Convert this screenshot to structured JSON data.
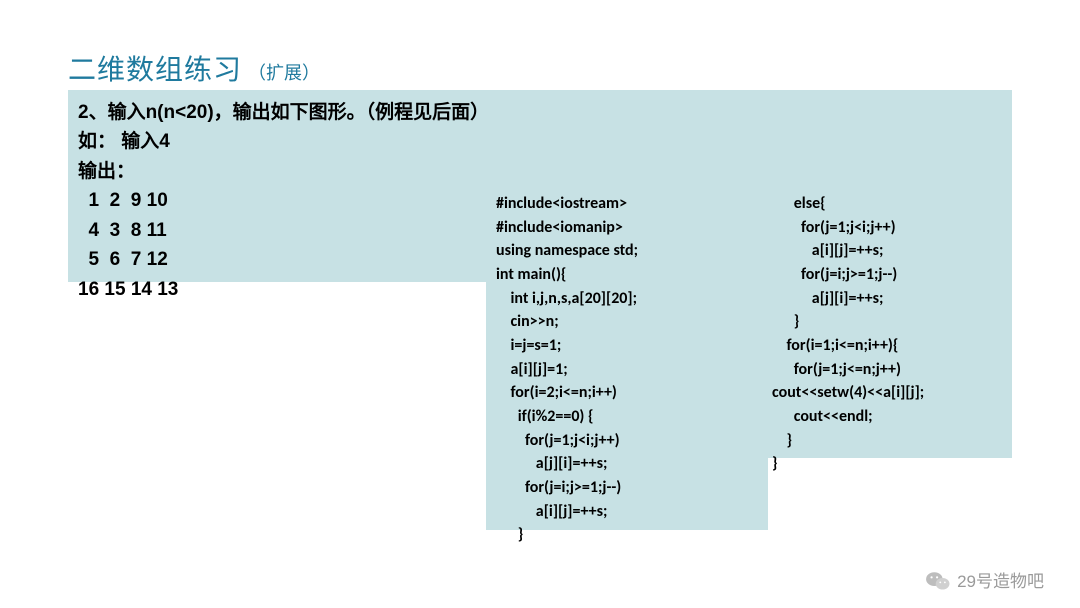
{
  "title": {
    "main": "二维数组练习",
    "sub": "（扩展）"
  },
  "problem": {
    "lines": [
      "2、输入n(n<20)，输出如下图形。（例程见后面）",
      "如： 输入4",
      "输出：",
      "  1  2  9 10",
      "  4  3  8 11",
      "  5  6  7 12",
      "16 15 14 13"
    ]
  },
  "code_left": [
    "#include<iostream>",
    "#include<iomanip>",
    "using namespace std;",
    "int main(){",
    "    int i,j,n,s,a[20][20];",
    "    cin>>n;",
    "    i=j=s=1;",
    "    a[i][j]=1;",
    "    for(i=2;i<=n;i++)",
    "      if(i%2==0) {",
    "        for(j=1;j<i;j++)",
    "           a[j][i]=++s;",
    "        for(j=i;j>=1;j--)",
    "           a[i][j]=++s;",
    "      }"
  ],
  "code_right": [
    "      else{",
    "        for(j=1;j<i;j++)",
    "           a[i][j]=++s;",
    "        for(j=i;j>=1;j--)",
    "           a[j][i]=++s;",
    "      }",
    "    for(i=1;i<=n;i++){",
    "      for(j=1;j<=n;j++)",
    "cout<<setw(4)<<a[i][j];",
    "      cout<<endl;",
    "    }",
    "}"
  ],
  "attribution": "29号造物吧"
}
